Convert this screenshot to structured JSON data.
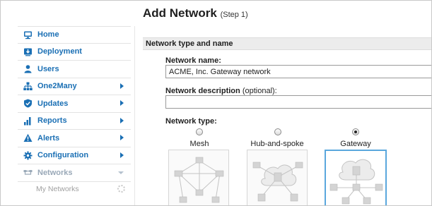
{
  "page": {
    "title": "Add Network",
    "step": "(Step 1)"
  },
  "sidebar": {
    "items": [
      {
        "label": "Home",
        "icon": "monitor-icon",
        "has_arrow": false
      },
      {
        "label": "Deployment",
        "icon": "download-icon",
        "has_arrow": false
      },
      {
        "label": "Users",
        "icon": "user-icon",
        "has_arrow": false
      },
      {
        "label": "One2Many",
        "icon": "hierarchy-icon",
        "has_arrow": true
      },
      {
        "label": "Updates",
        "icon": "shield-icon",
        "has_arrow": true
      },
      {
        "label": "Reports",
        "icon": "bar-chart-icon",
        "has_arrow": true
      },
      {
        "label": "Alerts",
        "icon": "warning-icon",
        "has_arrow": true
      },
      {
        "label": "Configuration",
        "icon": "gear-icon",
        "has_arrow": true
      },
      {
        "label": "Networks",
        "icon": "network-icon",
        "has_arrow": false
      }
    ],
    "sub_item": "My Networks",
    "accent_color": "#1a6fb4"
  },
  "section": {
    "title": "Network type and name"
  },
  "form": {
    "name_label": "Network name:",
    "name_value": "ACME, Inc. Gateway network",
    "description_label": "Network description",
    "description_optional": "(optional):",
    "description_value": "",
    "type_label": "Network type:"
  },
  "network_types": [
    {
      "label": "Mesh",
      "selected": false
    },
    {
      "label": "Hub-and-spoke",
      "selected": false
    },
    {
      "label": "Gateway",
      "selected": true
    }
  ]
}
